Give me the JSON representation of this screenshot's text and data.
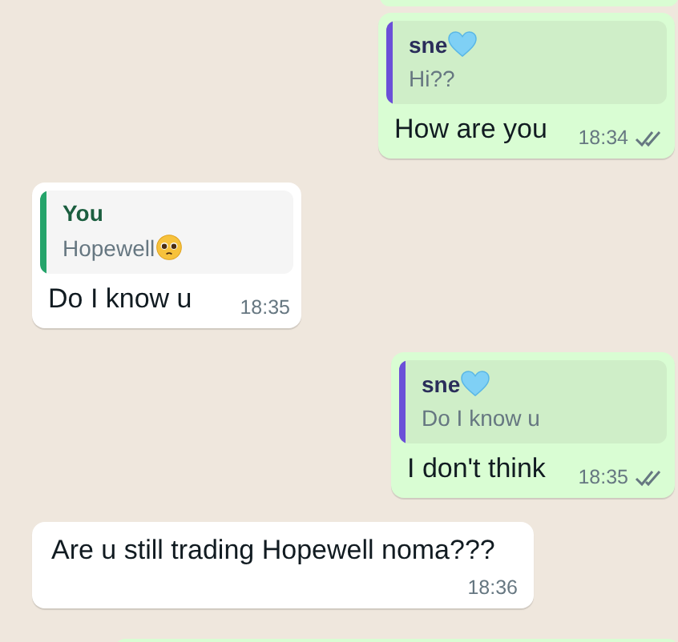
{
  "messages": [
    {
      "kind": "outgoing",
      "quote": {
        "author": [
          {
            "kind": "text",
            "text": "sne"
          },
          {
            "kind": "heart"
          }
        ],
        "color": "#6b4fd8",
        "text": [
          {
            "kind": "text",
            "text": "Hi??"
          }
        ]
      },
      "text": "How are you",
      "time": "18:34"
    },
    {
      "kind": "incoming",
      "quote": {
        "author": [
          {
            "kind": "text",
            "text": "You"
          }
        ],
        "color": "#25a46b",
        "text": [
          {
            "kind": "text",
            "text": "Hopewell"
          },
          {
            "kind": "face"
          }
        ]
      },
      "text": "Do I know u",
      "time": "18:35"
    },
    {
      "kind": "outgoing",
      "quote": {
        "author": [
          {
            "kind": "text",
            "text": "sne"
          },
          {
            "kind": "heart"
          }
        ],
        "color": "#6b4fd8",
        "text": [
          {
            "kind": "text",
            "text": "Do I know u"
          }
        ]
      },
      "text": "I don't think",
      "time": "18:35"
    },
    {
      "kind": "plain",
      "text": "Are u still trading Hopewell noma???",
      "time": "18:36"
    }
  ]
}
